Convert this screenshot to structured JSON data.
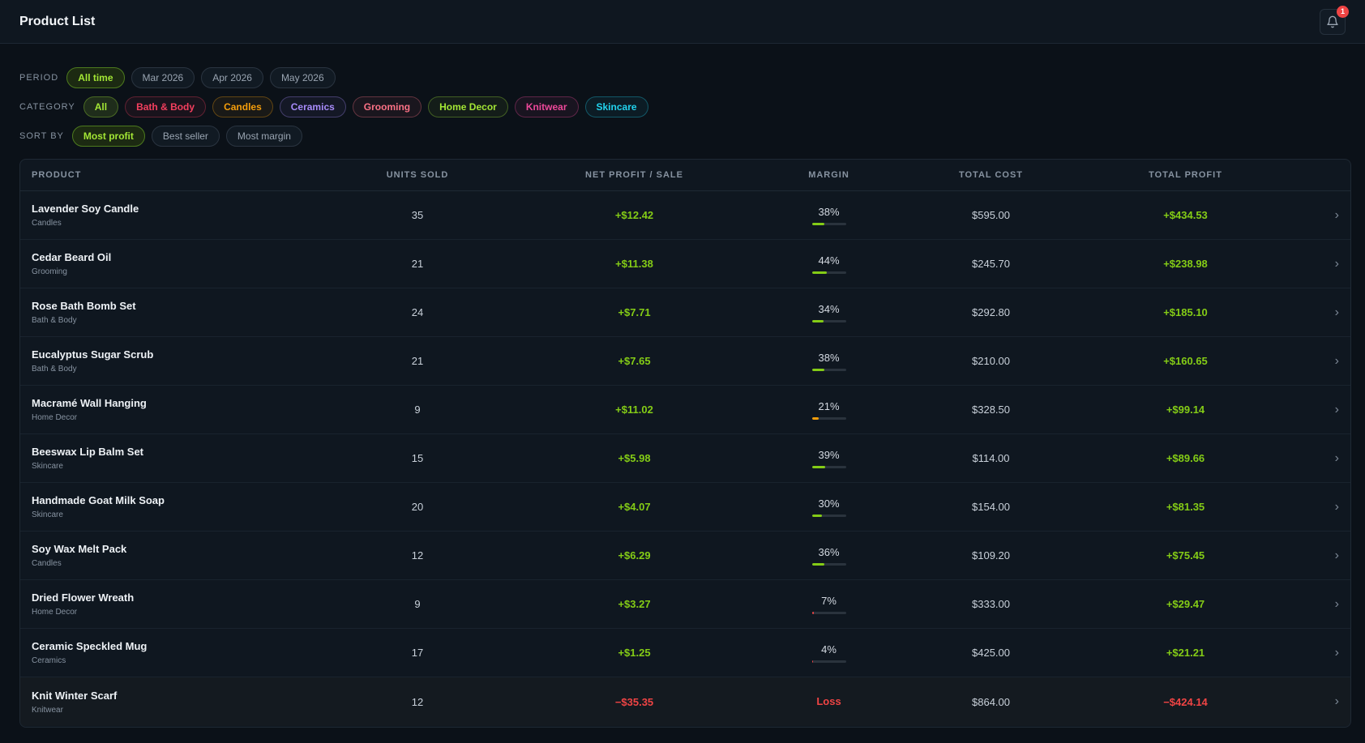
{
  "header": {
    "title": "Product List",
    "notification_count": "1"
  },
  "filters": {
    "period": {
      "label": "PERIOD",
      "options": [
        "All time",
        "Mar 2026",
        "Apr 2026",
        "May 2026"
      ],
      "selected": "All time"
    },
    "category": {
      "label": "CATEGORY",
      "options": [
        {
          "label": "All",
          "color": "#a3e635",
          "active": true
        },
        {
          "label": "Bath & Body",
          "color": "#f43f5e",
          "active": false
        },
        {
          "label": "Candles",
          "color": "#f59e0b",
          "active": false
        },
        {
          "label": "Ceramics",
          "color": "#a78bfa",
          "active": false
        },
        {
          "label": "Grooming",
          "color": "#fb7185",
          "active": false
        },
        {
          "label": "Home Decor",
          "color": "#a3e635",
          "active": false
        },
        {
          "label": "Knitwear",
          "color": "#ec4899",
          "active": false
        },
        {
          "label": "Skincare",
          "color": "#22d3ee",
          "active": false
        }
      ]
    },
    "sort": {
      "label": "SORT BY",
      "options": [
        "Most profit",
        "Best seller",
        "Most margin"
      ],
      "selected": "Most profit"
    }
  },
  "table": {
    "columns": [
      "PRODUCT",
      "UNITS SOLD",
      "NET PROFIT / SALE",
      "MARGIN",
      "TOTAL COST",
      "TOTAL PROFIT"
    ],
    "rows": [
      {
        "name": "Lavender Soy Candle",
        "category": "Candles",
        "units": "35",
        "net": "+$12.42",
        "margin": "38%",
        "margin_pct": 38,
        "cost": "$595.00",
        "profit": "+$434.53",
        "loss": false
      },
      {
        "name": "Cedar Beard Oil",
        "category": "Grooming",
        "units": "21",
        "net": "+$11.38",
        "margin": "44%",
        "margin_pct": 44,
        "cost": "$245.70",
        "profit": "+$238.98",
        "loss": false
      },
      {
        "name": "Rose Bath Bomb Set",
        "category": "Bath & Body",
        "units": "24",
        "net": "+$7.71",
        "margin": "34%",
        "margin_pct": 34,
        "cost": "$292.80",
        "profit": "+$185.10",
        "loss": false
      },
      {
        "name": "Eucalyptus Sugar Scrub",
        "category": "Bath & Body",
        "units": "21",
        "net": "+$7.65",
        "margin": "38%",
        "margin_pct": 38,
        "cost": "$210.00",
        "profit": "+$160.65",
        "loss": false
      },
      {
        "name": "Macramé Wall Hanging",
        "category": "Home Decor",
        "units": "9",
        "net": "+$11.02",
        "margin": "21%",
        "margin_pct": 21,
        "cost": "$328.50",
        "profit": "+$99.14",
        "loss": false
      },
      {
        "name": "Beeswax Lip Balm Set",
        "category": "Skincare",
        "units": "15",
        "net": "+$5.98",
        "margin": "39%",
        "margin_pct": 39,
        "cost": "$114.00",
        "profit": "+$89.66",
        "loss": false
      },
      {
        "name": "Handmade Goat Milk Soap",
        "category": "Skincare",
        "units": "20",
        "net": "+$4.07",
        "margin": "30%",
        "margin_pct": 30,
        "cost": "$154.00",
        "profit": "+$81.35",
        "loss": false
      },
      {
        "name": "Soy Wax Melt Pack",
        "category": "Candles",
        "units": "12",
        "net": "+$6.29",
        "margin": "36%",
        "margin_pct": 36,
        "cost": "$109.20",
        "profit": "+$75.45",
        "loss": false
      },
      {
        "name": "Dried Flower Wreath",
        "category": "Home Decor",
        "units": "9",
        "net": "+$3.27",
        "margin": "7%",
        "margin_pct": 7,
        "cost": "$333.00",
        "profit": "+$29.47",
        "loss": false
      },
      {
        "name": "Ceramic Speckled Mug",
        "category": "Ceramics",
        "units": "17",
        "net": "+$1.25",
        "margin": "4%",
        "margin_pct": 4,
        "cost": "$425.00",
        "profit": "+$21.21",
        "loss": false
      },
      {
        "name": "Knit Winter Scarf",
        "category": "Knitwear",
        "units": "12",
        "net": "−$35.35",
        "margin": "Loss",
        "margin_pct": 0,
        "cost": "$864.00",
        "profit": "−$424.14",
        "loss": true
      }
    ]
  },
  "colors": {
    "positive": "#84cc16",
    "negative": "#ef4444",
    "warn": "#f59e0b"
  }
}
